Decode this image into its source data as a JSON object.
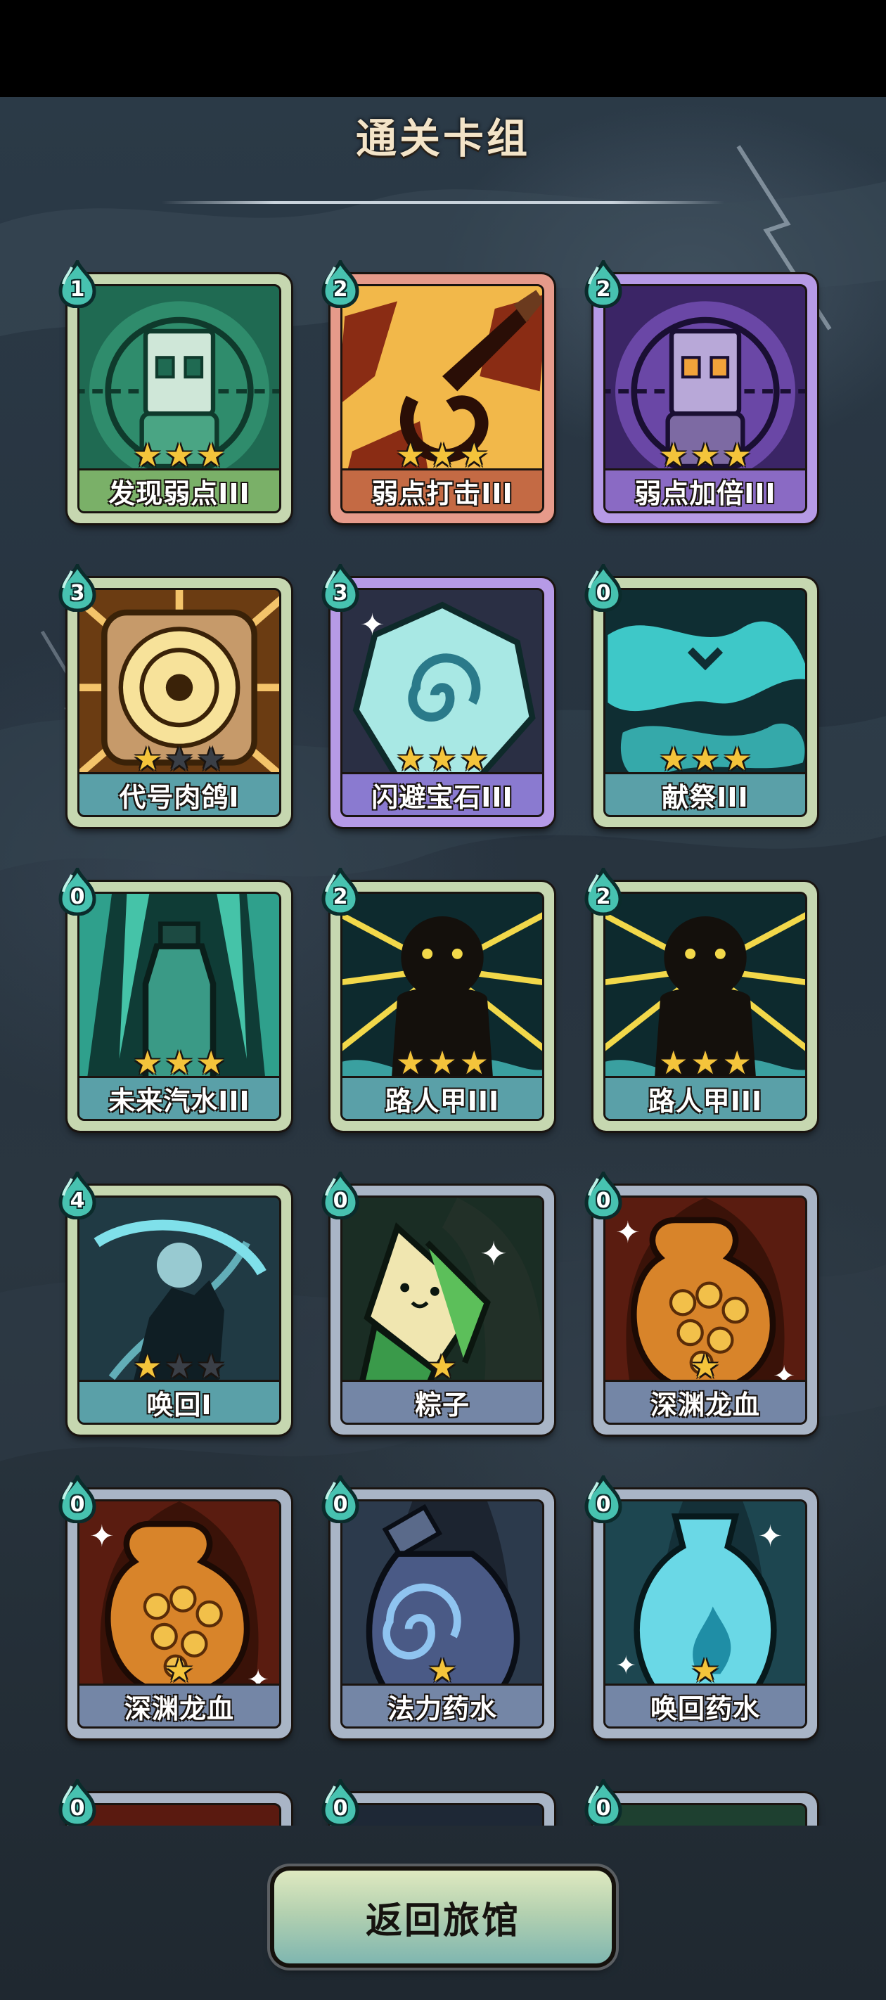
{
  "header": {
    "title": "通关卡组"
  },
  "colors": {
    "star_filled": "#f4c43b",
    "star_empty": "#3a3f47",
    "cost_gem": "#47c2b0"
  },
  "cards": [
    {
      "name": "发现弱点III",
      "cost": "1",
      "stars": 3,
      "stars_max": 3,
      "rarity": "common",
      "art": "target-robot-green"
    },
    {
      "name": "弱点打击III",
      "cost": "2",
      "stars": 3,
      "stars_max": 3,
      "rarity": "rare",
      "art": "knife-strike"
    },
    {
      "name": "弱点加倍III",
      "cost": "2",
      "stars": 3,
      "stars_max": 3,
      "rarity": "epic",
      "art": "target-robot-purple"
    },
    {
      "name": "代号肉鸽I",
      "cost": "3",
      "stars": 1,
      "stars_max": 3,
      "rarity": "common",
      "art": "golden-disc"
    },
    {
      "name": "闪避宝石III",
      "cost": "3",
      "stars": 3,
      "stars_max": 3,
      "rarity": "epic",
      "art": "swirl-gem"
    },
    {
      "name": "献祭III",
      "cost": "0",
      "stars": 3,
      "stars_max": 3,
      "rarity": "common",
      "art": "sacrifice-smoke"
    },
    {
      "name": "未来汽水III",
      "cost": "0",
      "stars": 3,
      "stars_max": 3,
      "rarity": "common",
      "art": "soda-bottle"
    },
    {
      "name": "路人甲III",
      "cost": "2",
      "stars": 3,
      "stars_max": 3,
      "rarity": "common",
      "art": "shadow-figure"
    },
    {
      "name": "路人甲III",
      "cost": "2",
      "stars": 3,
      "stars_max": 3,
      "rarity": "common",
      "art": "shadow-figure"
    },
    {
      "name": "唤回I",
      "cost": "4",
      "stars": 1,
      "stars_max": 3,
      "rarity": "common",
      "art": "recall-hand"
    },
    {
      "name": "粽子",
      "cost": "0",
      "stars": 1,
      "stars_max": 1,
      "rarity": "item",
      "art": "zongzi"
    },
    {
      "name": "深渊龙血",
      "cost": "0",
      "stars": 1,
      "stars_max": 1,
      "rarity": "item",
      "art": "dragon-blood"
    },
    {
      "name": "深渊龙血",
      "cost": "0",
      "stars": 1,
      "stars_max": 1,
      "rarity": "item",
      "art": "dragon-blood"
    },
    {
      "name": "法力药水",
      "cost": "0",
      "stars": 1,
      "stars_max": 1,
      "rarity": "item",
      "art": "mana-potion"
    },
    {
      "name": "唤回药水",
      "cost": "0",
      "stars": 1,
      "stars_max": 1,
      "rarity": "item",
      "art": "recall-potion"
    },
    {
      "name": "",
      "cost": "0",
      "stars": 0,
      "stars_max": 0,
      "rarity": "item",
      "art": "partial-red"
    },
    {
      "name": "",
      "cost": "0",
      "stars": 0,
      "stars_max": 0,
      "rarity": "item",
      "art": "partial-dark"
    },
    {
      "name": "",
      "cost": "0",
      "stars": 0,
      "stars_max": 0,
      "rarity": "item",
      "art": "partial-green"
    }
  ],
  "footer": {
    "back_label": "返回旅馆"
  }
}
